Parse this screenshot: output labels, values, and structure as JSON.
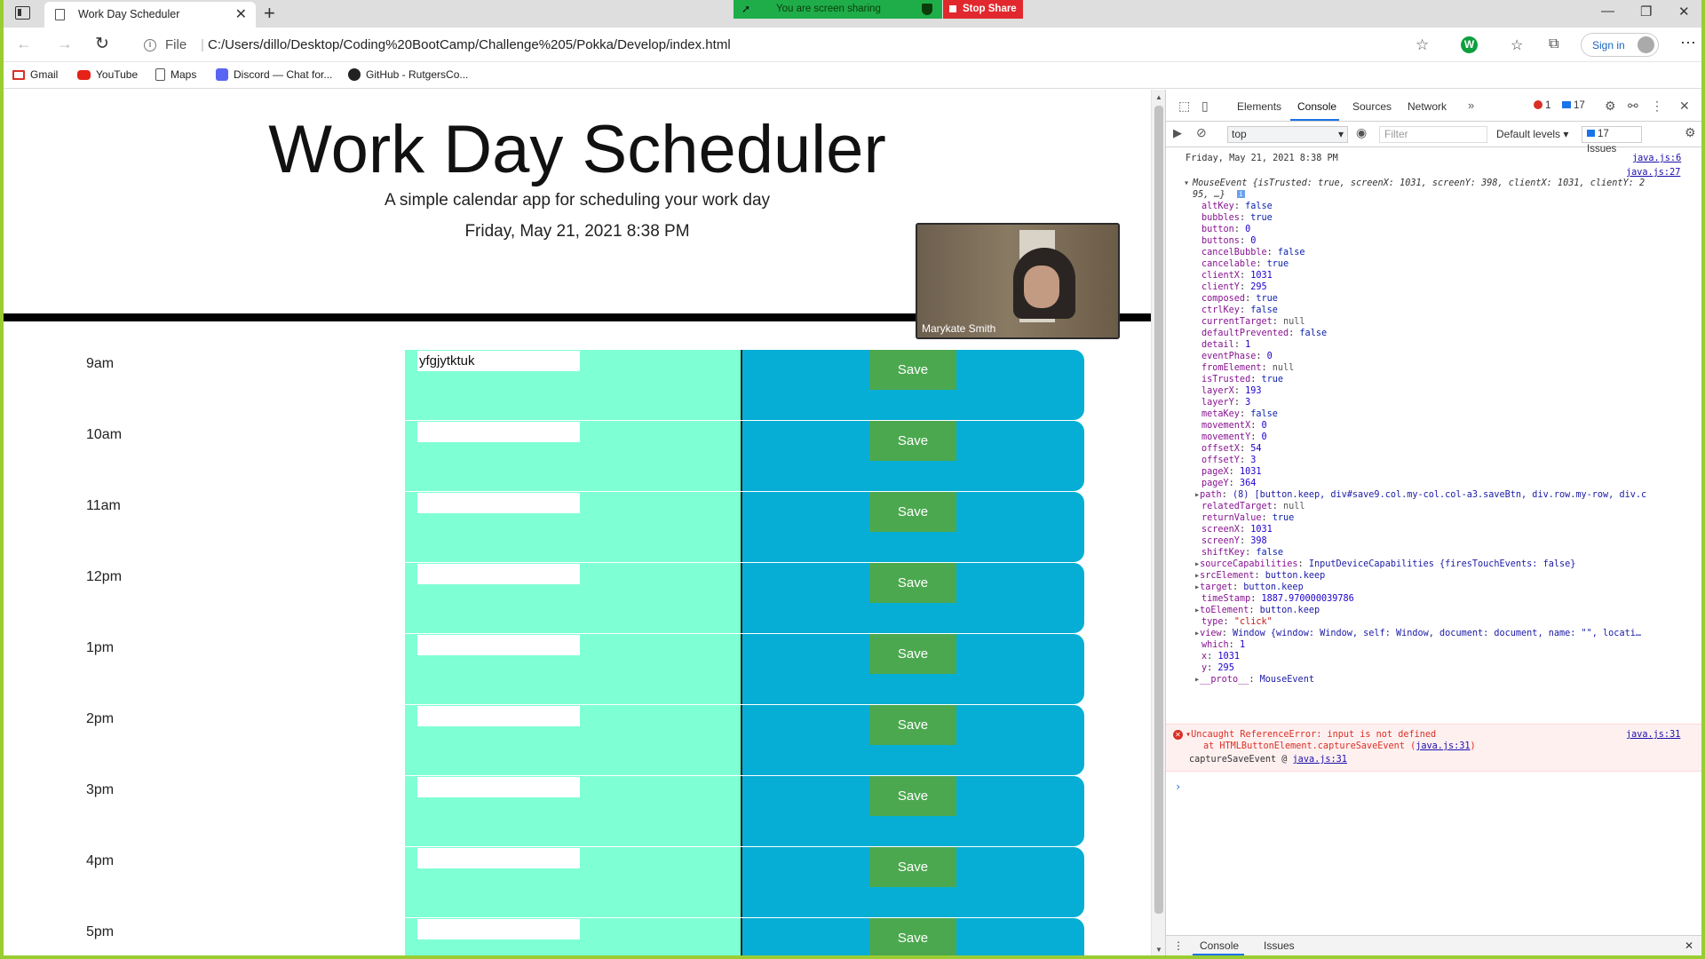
{
  "browser": {
    "tab_title": "Work Day Scheduler",
    "screen_share_text": "You are screen sharing",
    "stop_share_label": "Stop Share",
    "file_label": "File",
    "url": "C:/Users/dillo/Desktop/Coding%20BootCamp/Challenge%205/Pokka/Develop/index.html",
    "sign_in_label": "Sign in",
    "bookmarks": [
      "Gmail",
      "YouTube",
      "Maps",
      "Discord — Chat for...",
      "GitHub - RutgersCo..."
    ]
  },
  "page": {
    "title": "Work Day Scheduler",
    "lead": "A simple calendar app for scheduling your work day",
    "current_day": "Friday, May 21, 2021 8:38 PM",
    "save_label": "Save",
    "rows": [
      {
        "hour": "9am",
        "value": "yfgjytktuk"
      },
      {
        "hour": "10am",
        "value": ""
      },
      {
        "hour": "11am",
        "value": ""
      },
      {
        "hour": "12pm",
        "value": ""
      },
      {
        "hour": "1pm",
        "value": ""
      },
      {
        "hour": "2pm",
        "value": ""
      },
      {
        "hour": "3pm",
        "value": ""
      },
      {
        "hour": "4pm",
        "value": ""
      },
      {
        "hour": "5pm",
        "value": ""
      }
    ],
    "colors": {
      "future": "#7fffd4",
      "save_area": "#06aed5",
      "save_button": "#4ca84f"
    }
  },
  "video": {
    "participant_name": "Marykate Smith"
  },
  "devtools": {
    "tabs": [
      "Elements",
      "Console",
      "Sources",
      "Network"
    ],
    "active_tab": "Console",
    "error_count": "1",
    "message_count": "17",
    "context": "top",
    "filter_placeholder": "Filter",
    "levels_label": "Default levels ▾",
    "issues_label": "17 Issues",
    "log_date": "Friday, May 21, 2021 8:38 PM",
    "log_date_src": "java.js:6",
    "event_src": "java.js:27",
    "event_summary_1": "MouseEvent {isTrusted: true, screenX: 1031, screenY: 398, clientX: 1031, clientY: 2",
    "event_summary_2": "95, …}",
    "props": [
      {
        "k": "altKey",
        "v": "false",
        "t": "bool"
      },
      {
        "k": "bubbles",
        "v": "true",
        "t": "bool"
      },
      {
        "k": "button",
        "v": "0",
        "t": "num"
      },
      {
        "k": "buttons",
        "v": "0",
        "t": "num"
      },
      {
        "k": "cancelBubble",
        "v": "false",
        "t": "bool"
      },
      {
        "k": "cancelable",
        "v": "true",
        "t": "bool"
      },
      {
        "k": "clientX",
        "v": "1031",
        "t": "num"
      },
      {
        "k": "clientY",
        "v": "295",
        "t": "num"
      },
      {
        "k": "composed",
        "v": "true",
        "t": "bool"
      },
      {
        "k": "ctrlKey",
        "v": "false",
        "t": "bool"
      },
      {
        "k": "currentTarget",
        "v": "null",
        "t": "null"
      },
      {
        "k": "defaultPrevented",
        "v": "false",
        "t": "bool"
      },
      {
        "k": "detail",
        "v": "1",
        "t": "num"
      },
      {
        "k": "eventPhase",
        "v": "0",
        "t": "num"
      },
      {
        "k": "fromElement",
        "v": "null",
        "t": "null"
      },
      {
        "k": "isTrusted",
        "v": "true",
        "t": "bool"
      },
      {
        "k": "layerX",
        "v": "193",
        "t": "num"
      },
      {
        "k": "layerY",
        "v": "3",
        "t": "num"
      },
      {
        "k": "metaKey",
        "v": "false",
        "t": "bool"
      },
      {
        "k": "movementX",
        "v": "0",
        "t": "num"
      },
      {
        "k": "movementY",
        "v": "0",
        "t": "num"
      },
      {
        "k": "offsetX",
        "v": "54",
        "t": "num"
      },
      {
        "k": "offsetY",
        "v": "3",
        "t": "num"
      },
      {
        "k": "pageX",
        "v": "1031",
        "t": "num"
      },
      {
        "k": "pageY",
        "v": "364",
        "t": "num"
      },
      {
        "k": "path",
        "v": "(8) [button.keep, div#save9.col.my-col.col-a3.saveBtn, div.row.my-row, div.c",
        "t": "obj",
        "exp": true
      },
      {
        "k": "relatedTarget",
        "v": "null",
        "t": "null"
      },
      {
        "k": "returnValue",
        "v": "true",
        "t": "bool"
      },
      {
        "k": "screenX",
        "v": "1031",
        "t": "num"
      },
      {
        "k": "screenY",
        "v": "398",
        "t": "num"
      },
      {
        "k": "shiftKey",
        "v": "false",
        "t": "bool"
      },
      {
        "k": "sourceCapabilities",
        "v": "InputDeviceCapabilities {firesTouchEvents: false}",
        "t": "obj",
        "exp": true
      },
      {
        "k": "srcElement",
        "v": "button.keep",
        "t": "obj",
        "exp": true
      },
      {
        "k": "target",
        "v": "button.keep",
        "t": "obj",
        "exp": true
      },
      {
        "k": "timeStamp",
        "v": "1887.970000039786",
        "t": "num"
      },
      {
        "k": "toElement",
        "v": "button.keep",
        "t": "obj",
        "exp": true
      },
      {
        "k": "type",
        "v": "\"click\"",
        "t": "str"
      },
      {
        "k": "view",
        "v": "Window {window: Window, self: Window, document: document, name: \"\", locati…",
        "t": "obj",
        "exp": true
      },
      {
        "k": "which",
        "v": "1",
        "t": "num"
      },
      {
        "k": "x",
        "v": "1031",
        "t": "num"
      },
      {
        "k": "y",
        "v": "295",
        "t": "num"
      },
      {
        "k": "__proto__",
        "v": "MouseEvent",
        "t": "obj",
        "exp": true
      }
    ],
    "error_line_1": "▾Uncaught ReferenceError: input is not defined",
    "error_line_2": "at HTMLButtonElement.captureSaveEvent (",
    "error_line_2_link": "java.js:31",
    "error_line_2_tail": ")",
    "error_src": "java.js:31",
    "error_line_3": "captureSaveEvent @ ",
    "error_line_3_link": "java.js:31",
    "drawer_tabs": [
      "Console",
      "Issues"
    ]
  }
}
